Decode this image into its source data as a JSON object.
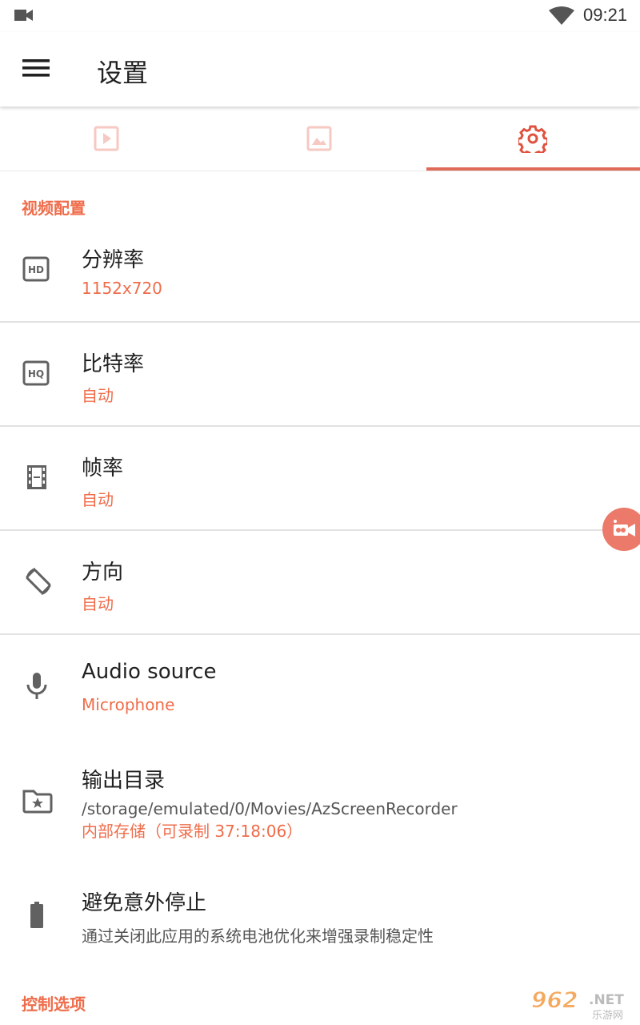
{
  "status_bar": {
    "time": "09:21"
  },
  "app_bar": {
    "title": "设置"
  },
  "tabs": [
    {
      "icon": "video-play-icon",
      "selected": false
    },
    {
      "icon": "image-icon",
      "selected": false
    },
    {
      "icon": "gear-icon",
      "selected": true
    }
  ],
  "colors": {
    "accent": "#ef6c4a",
    "tab_active": "#e0523f",
    "tab_inactive": "#f6c9c2"
  },
  "sections": {
    "video": "视频配置",
    "control": "控制选项"
  },
  "settings": [
    {
      "icon": "hd-icon",
      "title": "分辨率",
      "subtitle": "1152x720"
    },
    {
      "icon": "hq-icon",
      "title": "比特率",
      "subtitle": "自动"
    },
    {
      "icon": "film-icon",
      "title": "帧率",
      "subtitle": "自动"
    },
    {
      "icon": "screen-rotation-icon",
      "title": "方向",
      "subtitle": "自动"
    },
    {
      "icon": "microphone-icon",
      "title": "Audio source",
      "subtitle": "Microphone"
    },
    {
      "icon": "folder-star-icon",
      "title": "输出目录",
      "path": "/storage/emulated/0/Movies/AzScreenRecorder",
      "subtitle": "内部存储（可录制 37:18:06）"
    },
    {
      "icon": "battery-icon",
      "title": "避免意外停止",
      "description": "通过关闭此应用的系统电池优化来增强录制稳定性"
    }
  ],
  "watermark": {
    "number": "962",
    "suffix": ".NET",
    "caption": "乐游网"
  }
}
